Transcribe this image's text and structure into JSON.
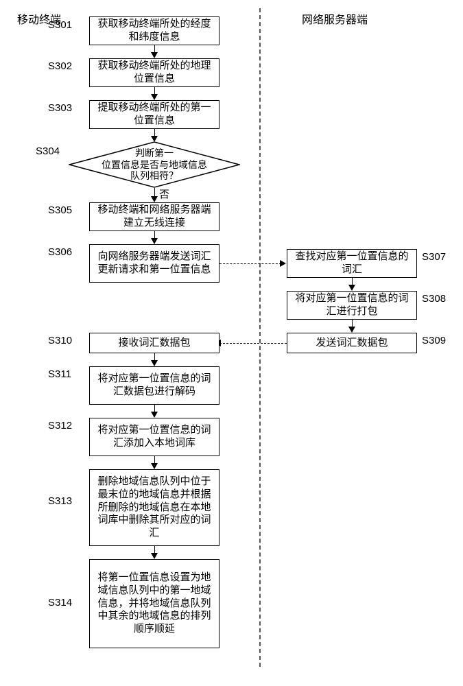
{
  "headers": {
    "left": "移动终端",
    "right": "网络服务器端"
  },
  "steps": {
    "s301": {
      "id": "S301",
      "text": "获取移动终端所处的经度和纬度信息"
    },
    "s302": {
      "id": "S302",
      "text": "获取移动终端所处的地理位置信息"
    },
    "s303": {
      "id": "S303",
      "text": "提取移动终端所处的第一位置信息"
    },
    "s304": {
      "id": "S304",
      "text": "判断第一\n位置信息是否与地域信息\n队列相符？"
    },
    "s305": {
      "id": "S305",
      "text": "移动终端和网络服务器端建立无线连接"
    },
    "s306": {
      "id": "S306",
      "text": "向网络服务器端发送词汇更新请求和第一位置信息"
    },
    "s307": {
      "id": "S307",
      "text": "查找对应第一位置信息的词汇"
    },
    "s308": {
      "id": "S308",
      "text": "将对应第一位置信息的词汇进行打包"
    },
    "s309": {
      "id": "S309",
      "text": "发送词汇数据包"
    },
    "s310": {
      "id": "S310",
      "text": "接收词汇数据包"
    },
    "s311": {
      "id": "S311",
      "text": "将对应第一位置信息的词汇数据包进行解码"
    },
    "s312": {
      "id": "S312",
      "text": "将对应第一位置信息的词汇添加入本地词库"
    },
    "s313": {
      "id": "S313",
      "text": "删除地域信息队列中位于最末位的地域信息并根据所删除的地域信息在本地词库中删除其所对应的词汇"
    },
    "s314": {
      "id": "S314",
      "text": "将第一位置信息设置为地域信息队列中的第一地域信息，并将地域信息队列中其余的地域信息的排列顺序顺延"
    }
  },
  "labels": {
    "no": "否"
  }
}
